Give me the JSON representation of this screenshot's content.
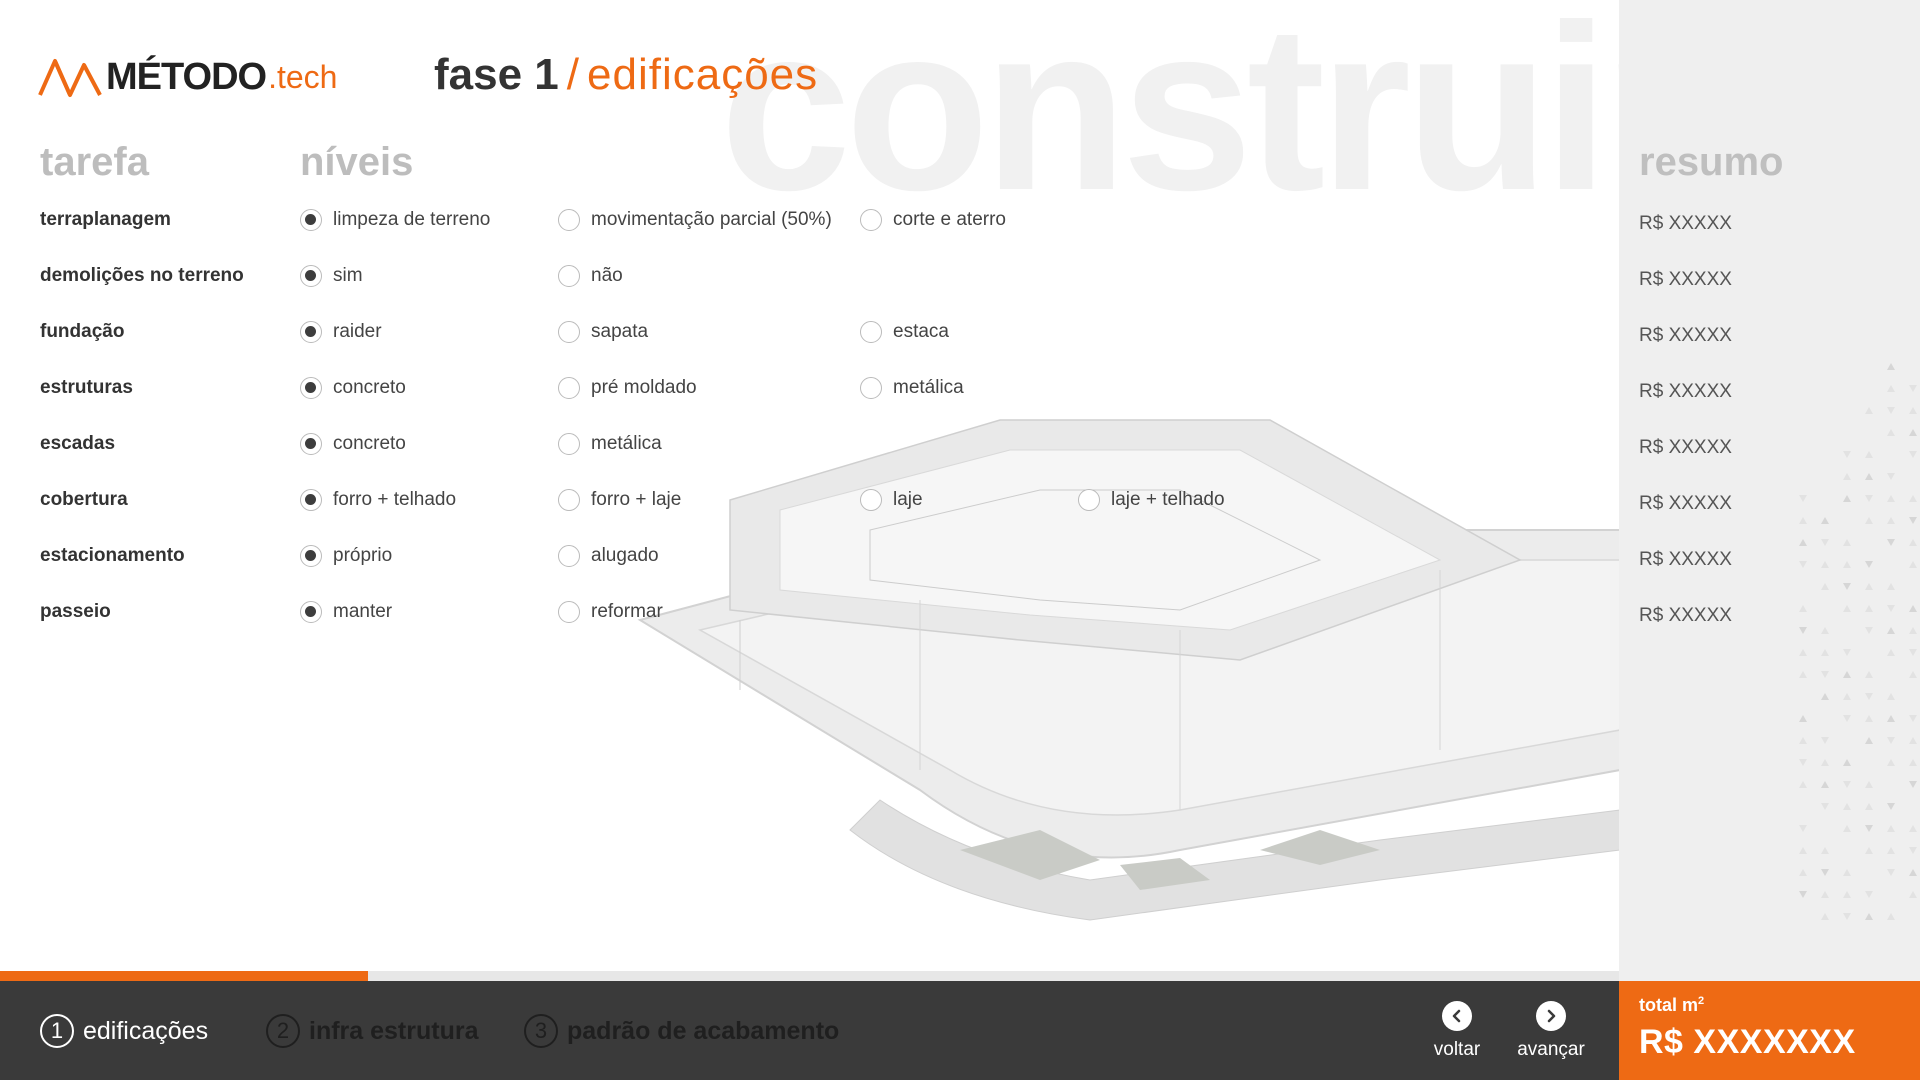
{
  "logo": {
    "main": "MÉTODO",
    "suffix": ".tech"
  },
  "header": {
    "phase": "fase 1",
    "separator": "/",
    "section": "edificações",
    "background_word": "construir"
  },
  "columns": {
    "task": "tarefa",
    "levels": "níveis",
    "summary": "resumo"
  },
  "tasks": [
    {
      "label": "terraplanagem",
      "options": [
        "limpeza de terreno",
        "movimentação parcial (50%)",
        "corte e aterro"
      ],
      "selected": 0,
      "price": "R$ XXXXX"
    },
    {
      "label": "demolições no terreno",
      "options": [
        "sim",
        "não"
      ],
      "selected": 0,
      "price": "R$ XXXXX"
    },
    {
      "label": "fundação",
      "options": [
        "raider",
        "sapata",
        "estaca"
      ],
      "selected": 0,
      "price": "R$ XXXXX"
    },
    {
      "label": "estruturas",
      "options": [
        "concreto",
        "pré moldado",
        "metálica"
      ],
      "selected": 0,
      "price": "R$ XXXXX"
    },
    {
      "label": "escadas",
      "options": [
        "concreto",
        "metálica"
      ],
      "selected": 0,
      "price": "R$ XXXXX"
    },
    {
      "label": "cobertura",
      "options": [
        "forro + telhado",
        "forro + laje",
        "laje",
        "laje + telhado"
      ],
      "selected": 0,
      "price": "R$ XXXXX"
    },
    {
      "label": "estacionamento",
      "options": [
        "próprio",
        "alugado"
      ],
      "selected": 0,
      "price": "R$ XXXXX"
    },
    {
      "label": "passeio",
      "options": [
        "manter",
        "reformar"
      ],
      "selected": 0,
      "price": "R$ XXXXX"
    }
  ],
  "progress": {
    "fraction": 0.2275
  },
  "steps": [
    {
      "number": "1",
      "label": "edificações",
      "active": true
    },
    {
      "number": "2",
      "label": "infra estrutura",
      "active": false
    },
    {
      "number": "3",
      "label": "padrão de acabamento",
      "active": false
    }
  ],
  "nav": {
    "back_label": "voltar",
    "next_label": "avançar",
    "back_icon": "chevron-left-icon",
    "next_icon": "chevron-right-icon"
  },
  "total": {
    "label": "total m",
    "superscript": "2",
    "value": "R$ XXXXXXX"
  },
  "colors": {
    "accent": "#ee6a14",
    "dark_bar": "#3a3a3a",
    "sidebar_bg": "#efefef",
    "header_gray": "#bdbdbd"
  }
}
